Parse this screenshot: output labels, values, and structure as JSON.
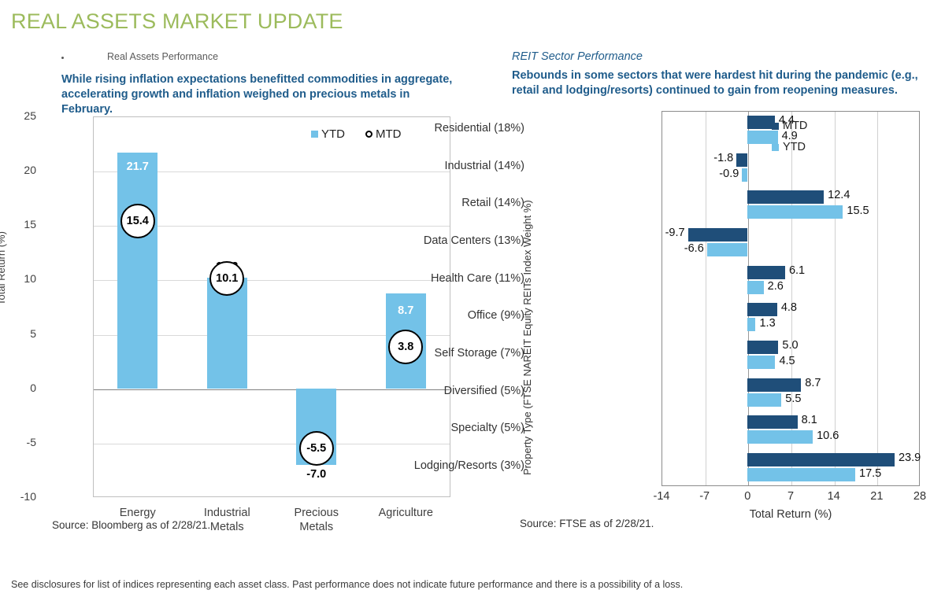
{
  "slide": {
    "title": "REAL ASSETS MARKET UPDATE",
    "title_color": "#9CBB5C",
    "disclosure": "See disclosures for list of indices representing each asset class. Past performance does not indicate future performance and there is a possibility of a loss."
  },
  "left": {
    "bullet_label": "Real Assets Performance",
    "subhead": "While rising inflation expectations benefitted commodities in aggregate, accelerating growth and inflation weighed on precious metals in February.",
    "source": "Source:  Bloomberg as of 2/28/21."
  },
  "right": {
    "eyebrow": "REIT Sector Performance",
    "subhead": "Rebounds in some sectors that were hardest hit during the pandemic (e.g., retail and lodging/resorts) continued to gain from reopening measures.",
    "source": "Source:  FTSE as of 2/28/21."
  },
  "chart_data": [
    {
      "id": "real-assets-performance",
      "type": "bar",
      "title": "Real Assets Performance",
      "orientation": "vertical",
      "xlabel": "",
      "ylabel": "Total Return (%)",
      "ylim": [
        -10,
        25
      ],
      "yticks": [
        25,
        20,
        15,
        10,
        5,
        0,
        -5,
        -10
      ],
      "grid": true,
      "legend_position": "top-right",
      "categories": [
        "Energy",
        "Industrial Metals",
        "Precious Metals",
        "Agriculture"
      ],
      "series": [
        {
          "name": "YTD",
          "marker": "square",
          "color": "#73C2E8",
          "values": [
            21.7,
            10.2,
            -7.0,
            8.7
          ]
        },
        {
          "name": "MTD",
          "marker": "circle",
          "color": "#FFFFFF",
          "values": [
            15.4,
            10.1,
            -5.5,
            3.8
          ]
        }
      ],
      "labels": {
        "ytd": [
          "21.7",
          "10.2",
          "-7.0",
          "8.7"
        ],
        "mtd": [
          "15.4",
          "10.1",
          "-5.5",
          "3.8"
        ]
      }
    },
    {
      "id": "reit-sector-performance",
      "type": "bar",
      "title": "REIT Sector Performance",
      "orientation": "horizontal",
      "xlabel": "Total Return (%)",
      "ylabel": "Property Type (FTSE NAREIT Equity REITs Index Weight %)",
      "xlim": [
        -14,
        28
      ],
      "xticks": [
        "-14",
        "-7",
        "0",
        "7",
        "14",
        "21",
        "28"
      ],
      "grid": true,
      "legend_position": "top-right",
      "categories": [
        "Residential (18%)",
        "Industrial (14%)",
        "Retail (14%)",
        "Data Centers (13%)",
        "Health Care (11%)",
        "Office (9%)",
        "Self Storage (7%)",
        "Diversified (5%)",
        "Specialty (5%)",
        "Lodging/Resorts (3%)"
      ],
      "series": [
        {
          "name": "MTD",
          "color": "#1F4E79",
          "values": [
            4.4,
            -1.8,
            12.4,
            -9.7,
            6.1,
            4.8,
            5.0,
            8.7,
            8.1,
            23.9
          ]
        },
        {
          "name": "YTD",
          "color": "#73C2E8",
          "values": [
            4.9,
            -0.9,
            15.5,
            -6.6,
            2.6,
            1.3,
            4.5,
            5.5,
            10.6,
            17.5
          ]
        }
      ],
      "labels": {
        "mtd": [
          "4.4",
          "-1.8",
          "12.4",
          "-9.7",
          "6.1",
          "4.8",
          "5.0",
          "8.7",
          "8.1",
          "23.9"
        ],
        "ytd": [
          "4.9",
          "-0.9",
          "15.5",
          "-6.6",
          "2.6",
          "1.3",
          "4.5",
          "5.5",
          "10.6",
          "17.5"
        ]
      }
    }
  ]
}
